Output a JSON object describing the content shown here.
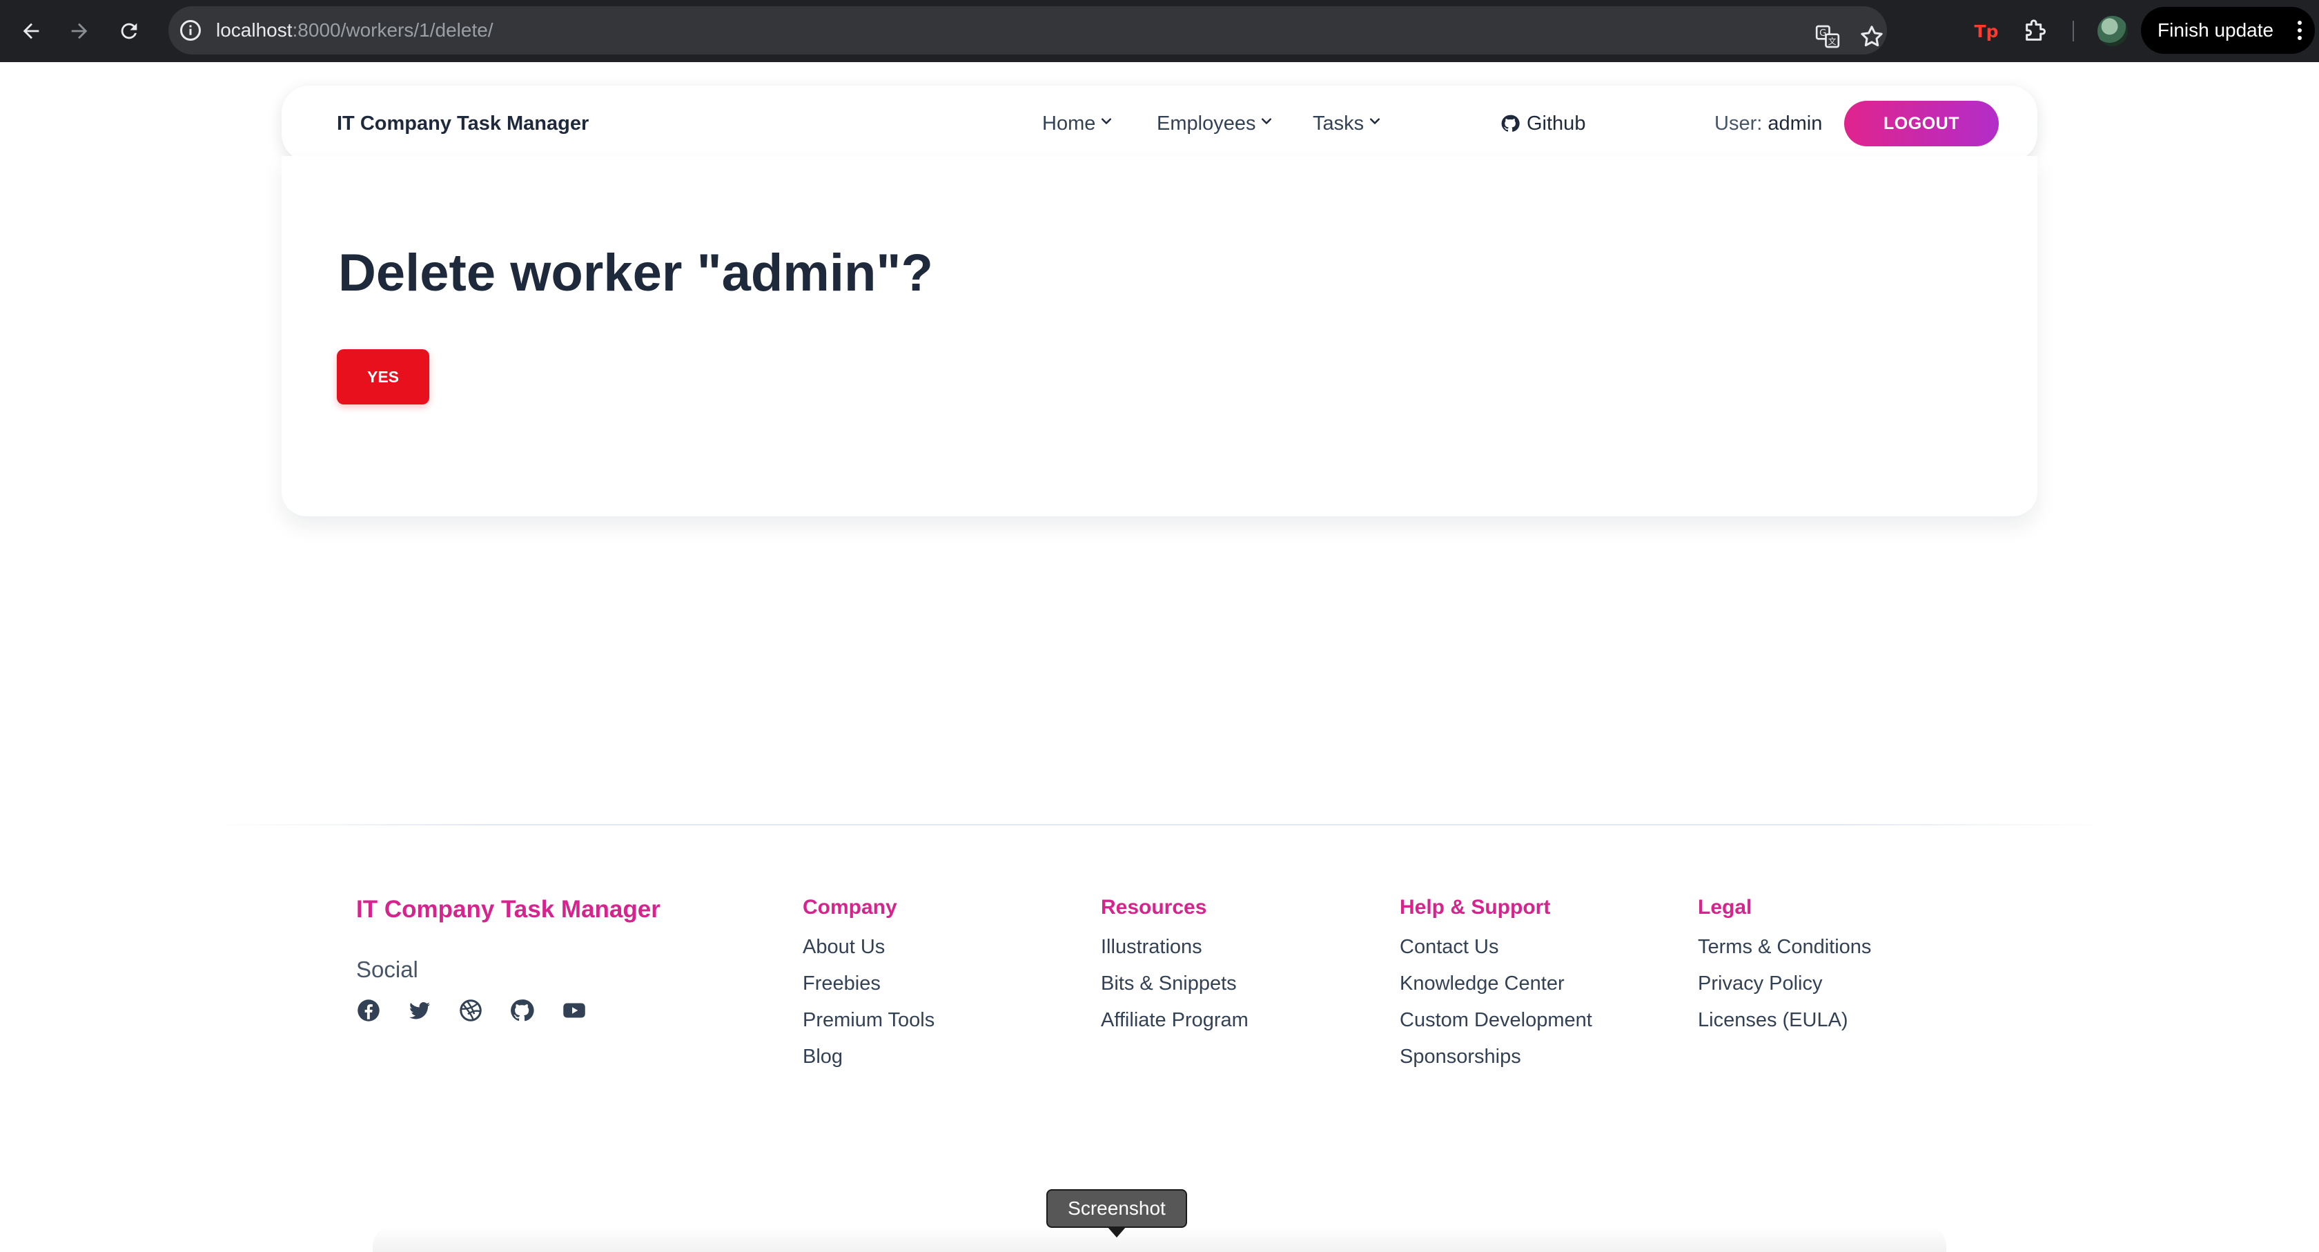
{
  "browser": {
    "url_host": "localhost",
    "url_path": ":8000/workers/1/delete/",
    "finish_update_label": "Finish update",
    "icons": [
      "back-arrow-icon",
      "forward-arrow-icon",
      "reload-icon",
      "site-info-icon",
      "translate-icon",
      "bookmark-star-icon",
      "extension-tp-icon",
      "extensions-puzzle-icon",
      "profile-avatar",
      "more-vert-icon"
    ]
  },
  "header": {
    "brand": "IT Company Task Manager",
    "menu": [
      {
        "label": "Home"
      },
      {
        "label": "Employees"
      },
      {
        "label": "Tasks"
      }
    ],
    "github_label": "Github",
    "user_prefix": "User:",
    "username": "admin",
    "logout_label": "LOGOUT"
  },
  "main": {
    "title": "Delete worker \"admin\"?",
    "confirm_label": "YES"
  },
  "footer": {
    "brand": "IT Company Task Manager",
    "social_title": "Social",
    "social_icons": [
      "facebook-icon",
      "twitter-icon",
      "dribbble-icon",
      "github-icon",
      "youtube-icon"
    ],
    "columns": [
      {
        "heading": "Company",
        "links": [
          "About Us",
          "Freebies",
          "Premium Tools",
          "Blog"
        ]
      },
      {
        "heading": "Resources",
        "links": [
          "Illustrations",
          "Bits & Snippets",
          "Affiliate Program"
        ]
      },
      {
        "heading": "Help & Support",
        "links": [
          "Contact Us",
          "Knowledge Center",
          "Custom Development",
          "Sponsorships"
        ]
      },
      {
        "heading": "Legal",
        "links": [
          "Terms & Conditions",
          "Privacy Policy",
          "Licenses (EULA)"
        ]
      }
    ]
  },
  "tooltip": {
    "label": "Screenshot"
  },
  "colors": {
    "accent_pink": "#d6248f",
    "logout_gradient_start": "#e0248d",
    "logout_gradient_end": "#b22dc9",
    "danger_red": "#e8101d",
    "text_dark": "#1e293b"
  }
}
